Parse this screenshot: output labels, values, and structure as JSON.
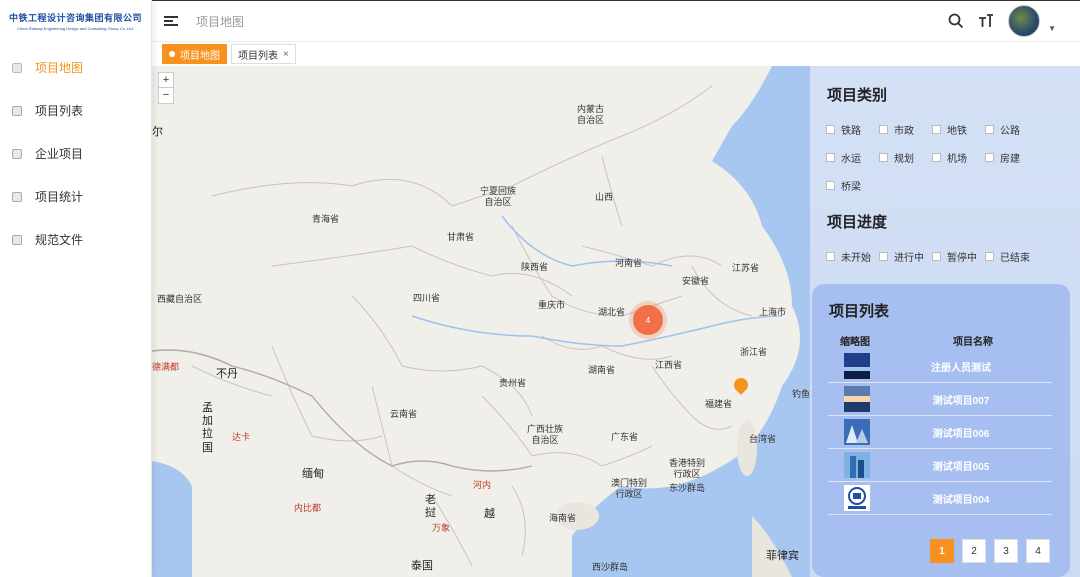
{
  "logo": {
    "cn": "中铁工程设计咨询集团有限公司",
    "en": "China Railway Engineering Design and Consulting Group Co.,Ltd."
  },
  "sidebar": {
    "items": [
      {
        "label": "项目地图",
        "active": true
      },
      {
        "label": "项目列表"
      },
      {
        "label": "企业项目"
      },
      {
        "label": "项目统计"
      },
      {
        "label": "规范文件"
      }
    ]
  },
  "header": {
    "breadcrumb": "项目地图",
    "search_icon": "search-icon",
    "font_icon": "font-size-icon"
  },
  "tabs": [
    {
      "label": "项目地图",
      "active": true
    },
    {
      "label": "项目列表",
      "closable": true
    }
  ],
  "map": {
    "zoom_in": "+",
    "zoom_out": "−",
    "cluster_count": "4",
    "labels": {
      "neimenggu": "内蒙古\n自治区",
      "ningxia": "宁夏回族\n自治区",
      "shanxi": "山西",
      "qinghai": "青海省",
      "gansu": "甘肃省",
      "shaanxi": "陕西省",
      "henan": "河南省",
      "anhui": "安徽省",
      "jiangsu": "江苏省",
      "xizang": "西藏自治区",
      "sichuan": "四川省",
      "chongqing": "重庆市",
      "hubei": "湖北省",
      "shanghai": "上海市",
      "zhejiang": "浙江省",
      "jiangxi": "江西省",
      "hunan": "湖南省",
      "guizhou": "贵州省",
      "fujian": "福建省",
      "yunnan": "云南省",
      "guangxi": "广西壮族\n自治区",
      "guangdong": "广东省",
      "taiwan": "台湾省",
      "hongkong": "香港特别\n行政区",
      "macau": "澳门特别\n行政区",
      "dongsha": "东沙群岛",
      "hainan": "海南省",
      "xisha": "西沙群岛",
      "philippines": "菲律宾",
      "diaoyu": "钓鱼岛",
      "budan": "不丹",
      "mengjialaguo": "孟\n加\n拉\n国",
      "miandian": "缅甸",
      "laowo": "老\n挝",
      "yuenan": "越",
      "taiguo": "泰国",
      "nier": "尔",
      "delhi": "德满都",
      "dhaka": "达卡",
      "naypyidaw": "内比都",
      "hanoi": "河内",
      "vientiane": "万象"
    }
  },
  "panel": {
    "category_title": "项目类别",
    "categories": [
      "铁路",
      "市政",
      "地铁",
      "公路",
      "水运",
      "规划",
      "机场",
      "房建",
      "桥梁"
    ],
    "progress_title": "项目进度",
    "progress": [
      "未开始",
      "进行中",
      "暂停中",
      "已结束"
    ],
    "list_title": "项目列表",
    "col_thumb": "缩略图",
    "col_name": "项目名称",
    "rows": [
      {
        "name": "注册人员测试"
      },
      {
        "name": "测试项目007"
      },
      {
        "name": "测试项目006"
      },
      {
        "name": "测试项目005"
      },
      {
        "name": "测试项目004"
      }
    ],
    "pages": [
      "1",
      "2",
      "3",
      "4"
    ]
  },
  "colors": {
    "accent": "#f7921e",
    "cluster": "#f26f4a",
    "panel_card": "#a0b9ee"
  }
}
